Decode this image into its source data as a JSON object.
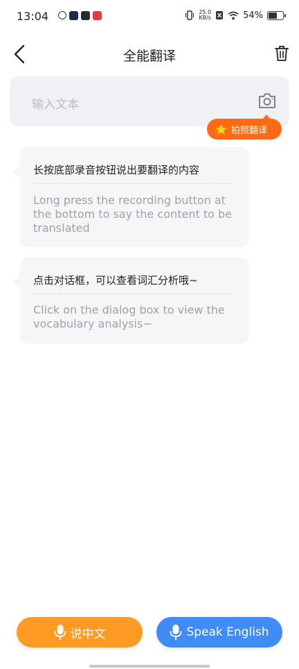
{
  "status_bar": {
    "time": "13:04",
    "net_speed_value": "25.0",
    "net_speed_unit": "KB/s",
    "battery_percent": "54%",
    "battery_level": 0.54
  },
  "header": {
    "title": "全能翻译"
  },
  "input": {
    "placeholder": "输入文本"
  },
  "photo_translate": {
    "label": "拍照翻译"
  },
  "hints": [
    {
      "zh": "长按底部录音按钮说出要翻译的内容",
      "en": "Long press the recording button at the bottom to say the content to be translated"
    },
    {
      "zh": "点击对话框，可以查看词汇分析哦~",
      "en": "Click on the dialog box to view the vocabulary analysis~"
    }
  ],
  "bottom_buttons": {
    "speak_chinese": "说中文",
    "speak_english": "Speak English"
  },
  "colors": {
    "orange_button": "#ff9a22",
    "blue_button": "#3f8cf7",
    "badge_orange": "#ff6a13",
    "bubble_bg": "#f5f6f8",
    "input_bg": "#f0f1f5"
  },
  "icons": [
    "back-arrow-icon",
    "trash-icon",
    "camera-icon",
    "star-icon",
    "mic-icon"
  ]
}
